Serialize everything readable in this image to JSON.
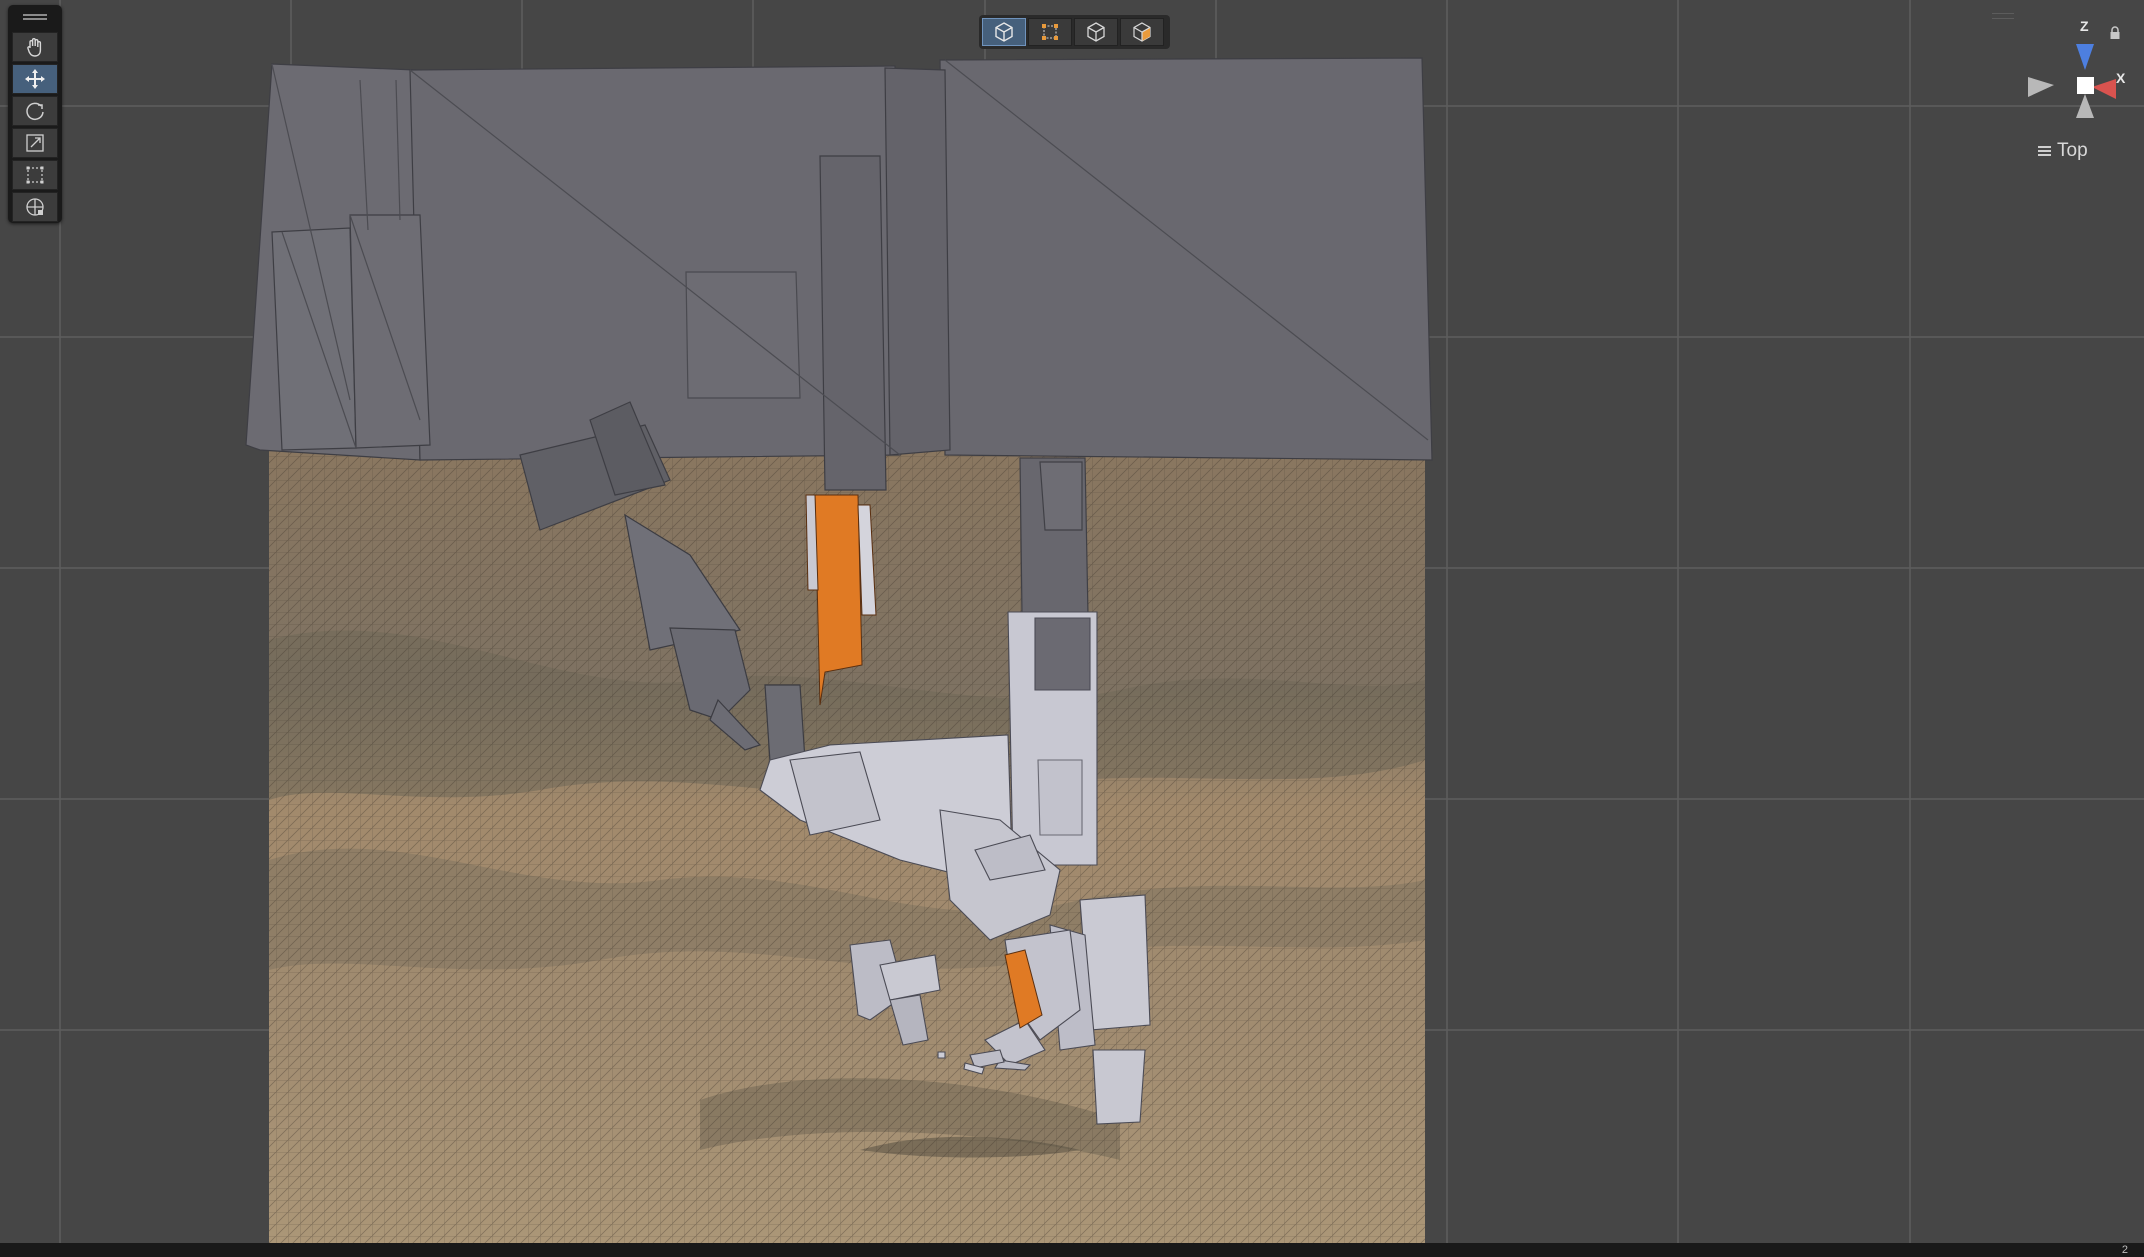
{
  "scene_view": {
    "orientation_label": "Top",
    "gizmo": {
      "z_label": "Z",
      "x_label": "X"
    },
    "status_text": "2"
  },
  "tools": [
    {
      "name": "hand-tool",
      "icon": "hand-icon",
      "active": false
    },
    {
      "name": "move-tool",
      "icon": "move-icon",
      "active": true
    },
    {
      "name": "rotate-tool",
      "icon": "rotate-icon",
      "active": false
    },
    {
      "name": "scale-tool",
      "icon": "scale-icon",
      "active": false
    },
    {
      "name": "rect-tool",
      "icon": "rect-icon",
      "active": false
    },
    {
      "name": "transform-tool",
      "icon": "transform-icon",
      "active": false
    }
  ],
  "selection_modes": [
    {
      "icon": "object-mode-icon",
      "active": true
    },
    {
      "icon": "vertex-mode-icon",
      "active": false
    },
    {
      "icon": "edge-mode-icon",
      "active": false
    },
    {
      "icon": "face-mode-icon",
      "active": false
    }
  ],
  "colors": {
    "background": "#464646",
    "terrain": "#9a8467",
    "roof": "#6b6a70",
    "debris": "#c8c8d2",
    "highlight": "#e07a24",
    "gizmo_x": "#d9534f",
    "gizmo_z": "#4d7fe0"
  }
}
